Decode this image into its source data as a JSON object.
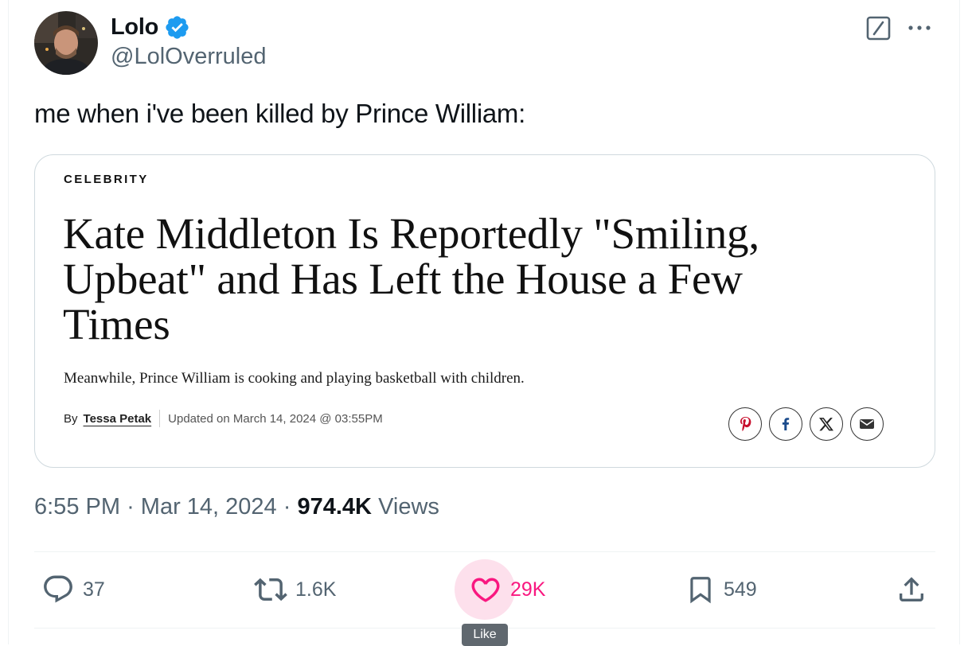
{
  "tweet": {
    "author": {
      "display_name": "Lolo",
      "handle": "@LolOverruled",
      "verified": true
    },
    "text": "me when i've been killed by Prince William:",
    "timestamp": {
      "time": "6:55 PM",
      "separator1": "·",
      "date": "Mar 14, 2024",
      "separator2": "·",
      "views_count": "974.4K",
      "views_label": "Views"
    }
  },
  "card": {
    "category": "CELEBRITY",
    "headline": "Kate Middleton Is Reportedly \"Smiling, Upbeat\" and Has Left the House a Few Times",
    "dek": "Meanwhile, Prince William is cooking and playing basketball with children.",
    "byline": {
      "by_label": "By",
      "author": "Tessa Petak",
      "updated": "Updated on March 14, 2024 @ 03:55PM"
    },
    "share_icons": [
      "pinterest-icon",
      "facebook-icon",
      "x-logo-icon",
      "mail-icon"
    ]
  },
  "actions": {
    "replies": "37",
    "reposts": "1.6K",
    "likes": "29K",
    "bookmarks": "549"
  },
  "tooltip": {
    "label": "Like"
  },
  "colors": {
    "verified_blue": "#1d9bf0",
    "like_pink": "#f91880",
    "muted_text": "#536471",
    "primary_text": "#0f1419",
    "card_border": "#cfd9de"
  }
}
